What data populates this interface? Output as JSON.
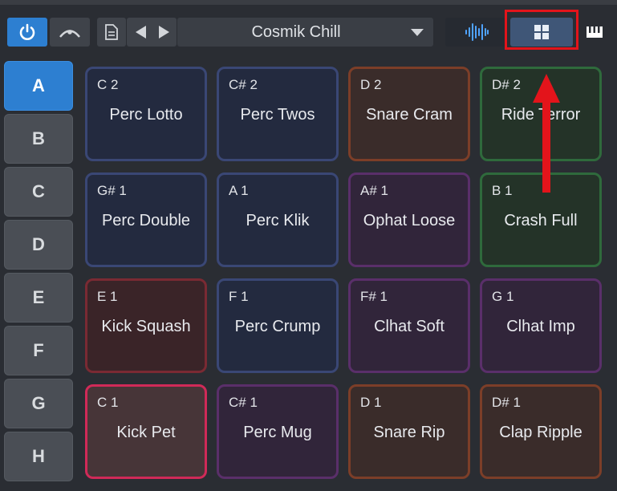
{
  "toolbar": {
    "power_icon": "power-icon",
    "curve_icon": "velocity-curve-icon",
    "doc_icon": "document-icon",
    "prev_icon": "prev-preset-icon",
    "next_icon": "next-preset-icon",
    "preset_name": "Cosmik Chill",
    "waveform_icon": "waveform-view-icon",
    "grid_icon": "pad-grid-view-icon",
    "keyboard_icon": "keyboard-icon"
  },
  "banks": [
    "A",
    "B",
    "C",
    "D",
    "E",
    "F",
    "G",
    "H"
  ],
  "active_bank": "A",
  "pads": [
    {
      "note": "C 2",
      "name": "Perc Lotto",
      "color": "#3a4775"
    },
    {
      "note": "C# 2",
      "name": "Perc Twos",
      "color": "#3a4775"
    },
    {
      "note": "D 2",
      "name": "Snare Cram",
      "color": "#7c3e28"
    },
    {
      "note": "D# 2",
      "name": "Ride Terror",
      "color": "#2f6a3c"
    },
    {
      "note": "G# 1",
      "name": "Perc Double",
      "color": "#3a4775"
    },
    {
      "note": "A 1",
      "name": "Perc Klik",
      "color": "#3a4775"
    },
    {
      "note": "A# 1",
      "name": "Ophat Loose",
      "color": "#5a2f6a"
    },
    {
      "note": "B 1",
      "name": "Crash Full",
      "color": "#2f6a3c"
    },
    {
      "note": "E 1",
      "name": "Kick Squash",
      "color": "#7a2a33"
    },
    {
      "note": "F 1",
      "name": "Perc Crump",
      "color": "#3a4775"
    },
    {
      "note": "F# 1",
      "name": "Clhat Soft",
      "color": "#5a2f6a"
    },
    {
      "note": "G 1",
      "name": "Clhat Imp",
      "color": "#5a2f6a"
    },
    {
      "note": "C 1",
      "name": "Kick Pet",
      "color": "#d02a58"
    },
    {
      "note": "C# 1",
      "name": "Perc Mug",
      "color": "#5a2f6a"
    },
    {
      "note": "D 1",
      "name": "Snare Rip",
      "color": "#7c3e28"
    },
    {
      "note": "D# 1",
      "name": "Clap Ripple",
      "color": "#7c3e28"
    }
  ],
  "colors": {
    "accent": "#2d7fd1",
    "highlight": "#e3141b"
  }
}
